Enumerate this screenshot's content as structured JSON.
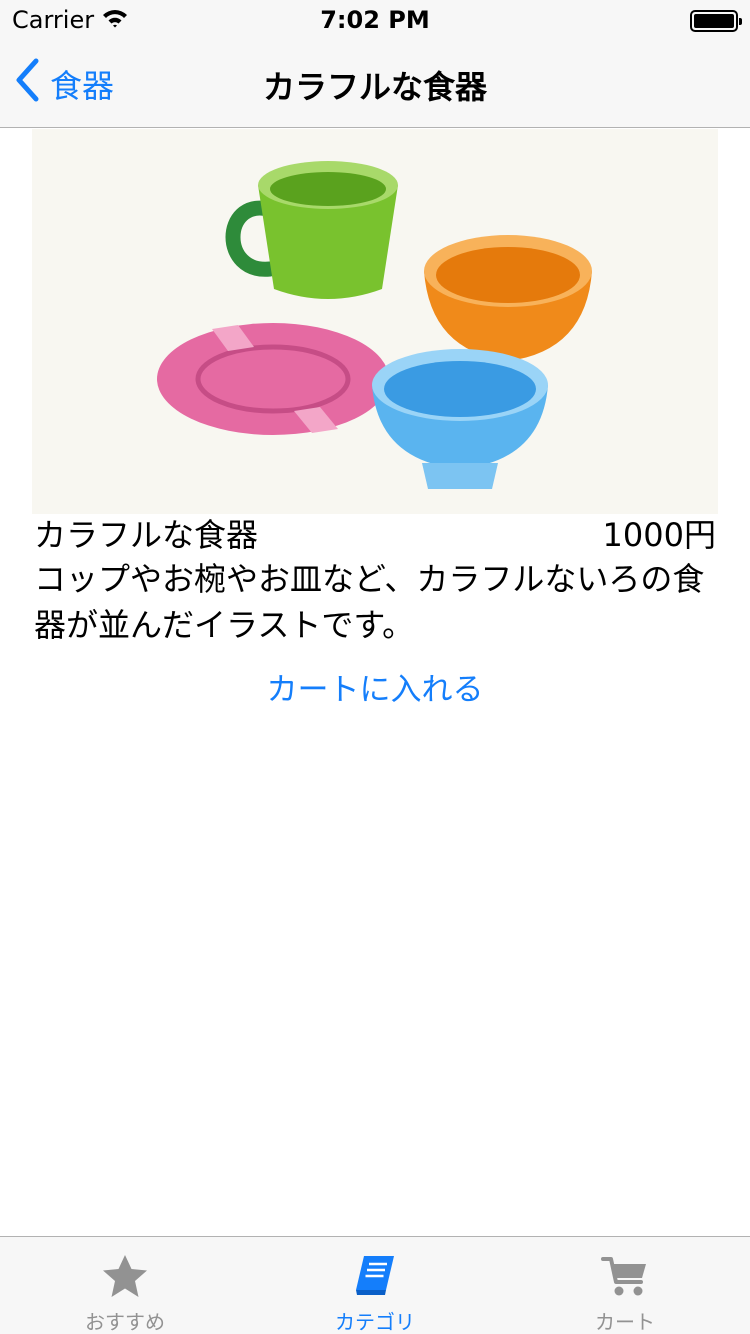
{
  "status_bar": {
    "carrier": "Carrier",
    "time": "7:02 PM"
  },
  "nav": {
    "back_label": "食器",
    "title": "カラフルな食器"
  },
  "product": {
    "image_icon": "colorful-tableware-illustration",
    "name": "カラフルな食器",
    "price": "1000円",
    "description": "コップやお椀やお皿など、カラフルないろの食器が並んだイラストです。",
    "add_to_cart_label": "カートに入れる"
  },
  "tab_bar": {
    "tabs": [
      {
        "label": "おすすめ",
        "icon": "star-icon",
        "selected": false
      },
      {
        "label": "カテゴリ",
        "icon": "book-icon",
        "selected": true
      },
      {
        "label": "カート",
        "icon": "cart-icon",
        "selected": false
      }
    ]
  },
  "colors": {
    "accent": "#147efb",
    "tab_inactive": "#929292",
    "bar_background": "#f7f7f7"
  }
}
